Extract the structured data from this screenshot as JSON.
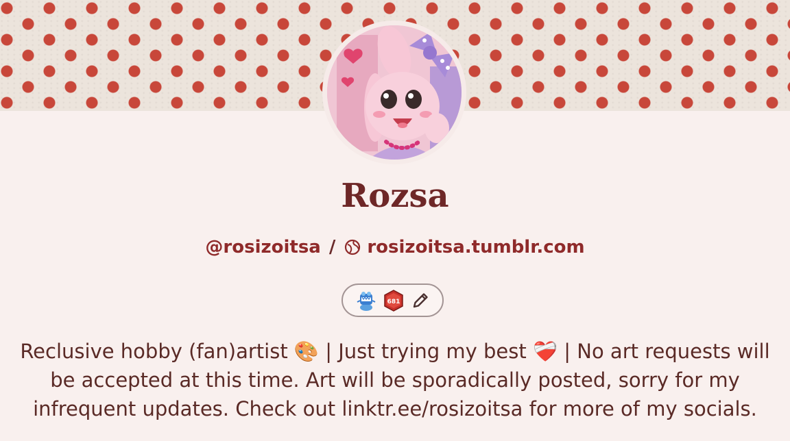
{
  "header": {
    "banner": "polka-dot-banner"
  },
  "profile": {
    "name": "Rozsa",
    "handle": "@rosizoitsa",
    "separator": "/",
    "url": "rosizoitsa.tumblr.com",
    "badges": [
      {
        "icon": "blue-cartoon-badge-icon"
      },
      {
        "icon": "number-badge-icon",
        "label": "681"
      },
      {
        "icon": "pencil-icon"
      }
    ],
    "bio": "Reclusive hobby (fan)artist 🎨 | Just trying my best ❤️‍🩹 | No art requests will be accepted at this time. Art will be sporadically posted, sorry for my infrequent updates. Check out linktr.ee/rosizoitsa for more of my socials."
  },
  "colors": {
    "accent": "#8f2a2a",
    "title": "#6e2727",
    "background": "#f9f0ee",
    "dots": "#c8473a"
  }
}
